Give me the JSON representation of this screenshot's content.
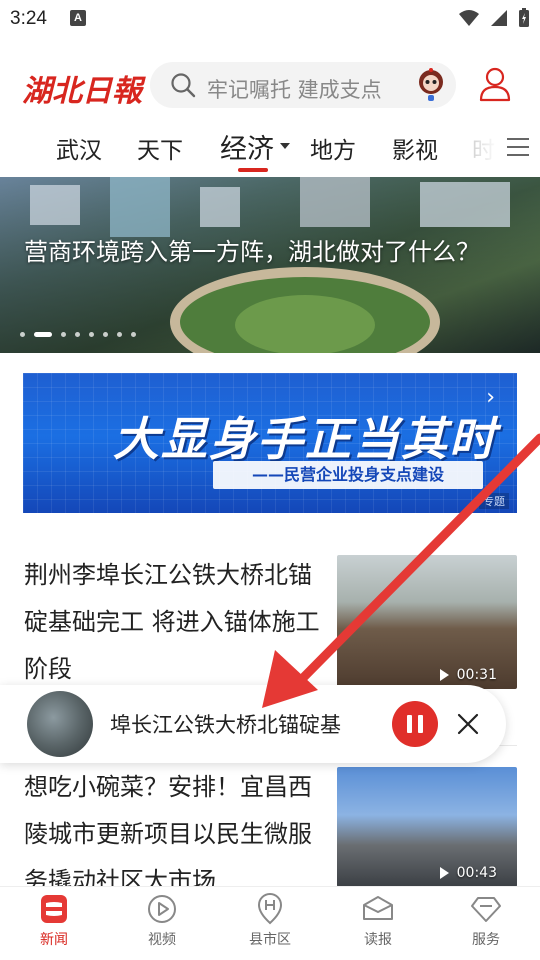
{
  "status_bar": {
    "time": "3:24",
    "notif_letter": "A"
  },
  "header": {
    "logo": "湖北日報",
    "search_placeholder": "牢记嘱托 建成支点"
  },
  "tabs": [
    "武汉",
    "天下",
    "经济",
    "地方",
    "影视",
    "时"
  ],
  "active_tab_index": 2,
  "hero": {
    "title": "营商环境跨入第一方阵，湖北做对了什么？",
    "slide_count": 8,
    "active_slide": 1
  },
  "banner": {
    "title": "大显身手正当其时",
    "subtitle": "——民营企业投身支点建设",
    "tag": "专题"
  },
  "articles": [
    {
      "title": "荆州李埠长江公铁大桥北锚碇基础完工 将进入锚体施工阶段",
      "duration": "00:31"
    },
    {
      "title": " 想吃小碗菜？安排！宜昌西陵城市更新项目以民生微服务撬动社区大市场",
      "duration": "00:43"
    }
  ],
  "player": {
    "title": "埠长江公铁大桥北锚碇基"
  },
  "bottom_nav": [
    {
      "label": "新闻",
      "icon": "news-icon"
    },
    {
      "label": "视频",
      "icon": "video-icon"
    },
    {
      "label": "县市区",
      "icon": "county-icon"
    },
    {
      "label": "读报",
      "icon": "newspaper-icon"
    },
    {
      "label": "服务",
      "icon": "service-icon"
    }
  ],
  "colors": {
    "brand_red": "#d8261f",
    "banner_blue": "#1b6fe3"
  }
}
